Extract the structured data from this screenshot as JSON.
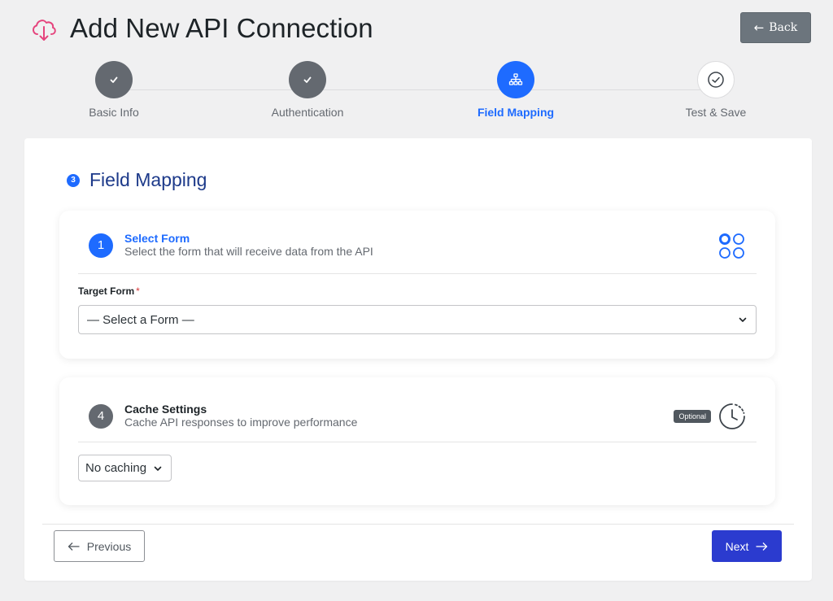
{
  "header": {
    "title": "Add New API Connection",
    "back_label": "Back",
    "icon": "cloud-download-icon"
  },
  "stepper": {
    "steps": [
      {
        "label": "Basic Info",
        "status": "done"
      },
      {
        "label": "Authentication",
        "status": "done"
      },
      {
        "label": "Field Mapping",
        "status": "active"
      },
      {
        "label": "Test & Save",
        "status": "pending"
      }
    ]
  },
  "section": {
    "number": "3",
    "title": "Field Mapping"
  },
  "select_form": {
    "number": "1",
    "title": "Select Form",
    "description": "Select the form that will receive data from the API",
    "field_label": "Target Form",
    "required_mark": "*",
    "select_value": "— Select a Form —"
  },
  "cache_settings": {
    "number": "4",
    "title": "Cache Settings",
    "description": "Cache API responses to improve performance",
    "badge": "Optional",
    "select_value": "No caching"
  },
  "footer": {
    "previous_label": "Previous",
    "next_label": "Next"
  },
  "colors": {
    "accent": "#1e6bff",
    "next_button": "#2b3bcf",
    "done_step": "#646970",
    "title_blue": "#1d3a8a"
  }
}
